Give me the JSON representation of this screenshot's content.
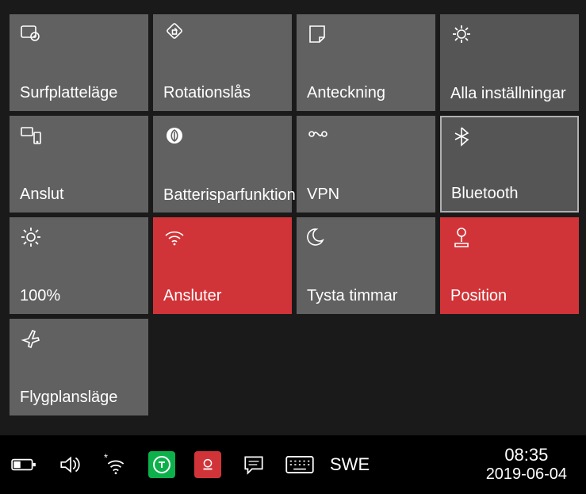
{
  "tiles": {
    "tablet": {
      "label": "Surfplatteläge"
    },
    "rotation": {
      "label": "Rotationslås"
    },
    "note": {
      "label": "Anteckning"
    },
    "settings": {
      "label": "Alla inställningar"
    },
    "connect": {
      "label": "Anslut"
    },
    "battery": {
      "label": "Batterisparfunktion"
    },
    "vpn": {
      "label": "VPN"
    },
    "bluetooth": {
      "label": "Bluetooth"
    },
    "brightness": {
      "label": "100%"
    },
    "wifi": {
      "label": "Ansluter"
    },
    "quiet": {
      "label": "Tysta timmar"
    },
    "location": {
      "label": "Position"
    },
    "airplane": {
      "label": "Flygplansläge"
    }
  },
  "taskbar": {
    "language": "SWE",
    "time": "08:35",
    "date": "2019-06-04"
  }
}
